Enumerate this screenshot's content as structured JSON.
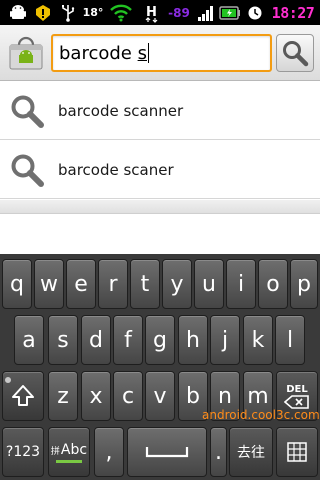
{
  "status_bar": {
    "temperature": "18°",
    "signal_dbm": "-89",
    "network_type": "H",
    "time": "18:27",
    "icons": [
      "android-icon",
      "warning-icon",
      "usb-icon",
      "wifi-icon",
      "h-network-icon",
      "signal-bars-icon",
      "battery-icon",
      "clock-icon"
    ],
    "colors": {
      "time": "#ff2fd0",
      "dbm": "#8a2be2",
      "wifi": "#22c322",
      "battery": "#22c322"
    }
  },
  "search": {
    "app_icon": "market-bag-icon",
    "query_prefix": "barcode ",
    "query_current_word": "s",
    "button_icon": "magnifier-icon",
    "accent_color": "#f39c12"
  },
  "suggestions": [
    {
      "icon": "magnifier-icon",
      "text": "barcode scanner"
    },
    {
      "icon": "magnifier-icon",
      "text": "barcode scaner"
    }
  ],
  "keyboard": {
    "row1": [
      "q",
      "w",
      "e",
      "r",
      "t",
      "y",
      "u",
      "i",
      "o",
      "p"
    ],
    "row2": [
      "a",
      "s",
      "d",
      "f",
      "g",
      "h",
      "j",
      "k",
      "l"
    ],
    "row3": [
      "z",
      "x",
      "c",
      "v",
      "b",
      "n",
      "m"
    ],
    "del_label": "DEL",
    "symbols_label": "?123",
    "lang_label": "Abc",
    "comma": ",",
    "period": ".",
    "chinese_label": "去往"
  },
  "watermark": "android.cool3c.com"
}
